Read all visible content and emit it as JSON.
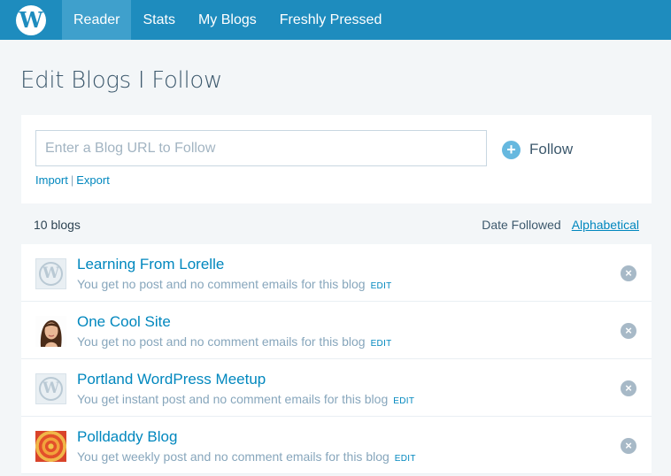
{
  "nav": {
    "logo_icon": "wordpress-logo-icon",
    "items": [
      {
        "label": "Reader",
        "active": true
      },
      {
        "label": "Stats",
        "active": false
      },
      {
        "label": "My Blogs",
        "active": false
      },
      {
        "label": "Freshly Pressed",
        "active": false
      }
    ]
  },
  "page": {
    "title": "Edit Blogs I Follow"
  },
  "follow_form": {
    "input_value": "",
    "input_placeholder": "Enter a Blog URL to Follow",
    "follow_label": "Follow",
    "follow_icon": "plus-circle-icon",
    "import_label": "Import",
    "separator": "|",
    "export_label": "Export"
  },
  "list": {
    "count_label": "10 blogs",
    "sort_date_label": "Date Followed",
    "sort_alpha_label": "Alphabetical",
    "edit_label": "EDIT",
    "remove_icon": "remove-x-icon",
    "blogs": [
      {
        "name": "Learning From Lorelle",
        "desc": "You get no post and no comment emails for this blog",
        "icon": "wordpress-blavatar-icon"
      },
      {
        "name": "One Cool Site",
        "desc": "You get no post and no comment emails for this blog",
        "icon": "avatar-photo-icon"
      },
      {
        "name": "Portland WordPress Meetup",
        "desc": "You get instant post and no comment emails for this blog",
        "icon": "wordpress-blavatar-icon"
      },
      {
        "name": "Polldaddy Blog",
        "desc": "You get weekly post and no comment emails for this blog",
        "icon": "polldaddy-target-icon"
      }
    ]
  },
  "colors": {
    "topbar": "#1e8cbe",
    "active_tab": "#3fa0cc",
    "link": "#0087be",
    "muted": "#87a6bc"
  }
}
